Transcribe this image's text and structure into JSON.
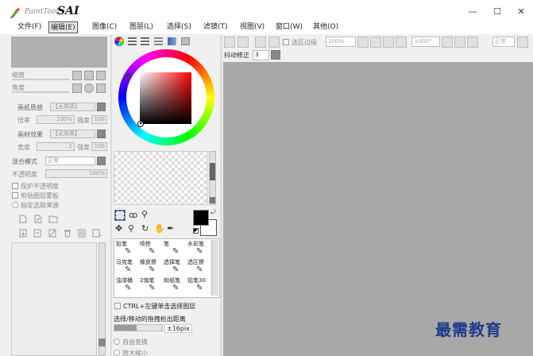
{
  "app": {
    "logo_small": "PaintTool",
    "logo_big": "SAI",
    "window_controls": [
      "—",
      "☐",
      "✕"
    ]
  },
  "menu": [
    {
      "label": "文件(F)"
    },
    {
      "label": "编辑(E)"
    },
    {
      "label": "图像(C)"
    },
    {
      "label": "图层(L)"
    },
    {
      "label": "选择(S)"
    },
    {
      "label": "滤镜(T)"
    },
    {
      "label": "视图(V)"
    },
    {
      "label": "窗口(W)"
    },
    {
      "label": "其他(O)"
    }
  ],
  "left_panel": {
    "zoom_label": "缩放",
    "angle_label": "角度",
    "paper_texture": {
      "label": "画纸质感",
      "value": "【无质感】",
      "scale_label": "倍率",
      "scale_value": "100%",
      "strength_label": "强度",
      "strength_value": "100"
    },
    "paper_effect": {
      "label": "画材效果",
      "value": "【无效果】",
      "width_label": "宽度",
      "width_value": "1",
      "strength_label": "强度",
      "strength_value": "100"
    },
    "blend": {
      "label": "混合模式",
      "value": "正常"
    },
    "opacity": {
      "label": "不透明度",
      "value": "100%"
    },
    "checks": [
      "保护不透明度",
      "剪贴图层蒙板",
      "指定选取来源"
    ]
  },
  "mid_panel": {
    "tools": [
      {
        "label": "铅笔"
      },
      {
        "label": "喷枪"
      },
      {
        "label": "笔"
      },
      {
        "label": "水彩笔"
      },
      {
        "label": "马克笔"
      },
      {
        "label": "橡皮擦"
      },
      {
        "label": "选择笔"
      },
      {
        "label": "选区擦"
      },
      {
        "label": "油漆桶"
      },
      {
        "label": "2值笔"
      },
      {
        "label": "和纸笔"
      },
      {
        "label": "铅笔30"
      }
    ],
    "ctrl_label": "CTRL+左键单击选择图层",
    "drag_label": "选择/移动的拖拽检出距离",
    "drag_value": "±16pix",
    "radio_labels": [
      "自由变换",
      "放大缩小"
    ]
  },
  "toolbar": {
    "selection_edge_label": "选区边缘",
    "zoom_value": "100%",
    "angle_value": "+000°",
    "blend_value": "正常",
    "stabilizer_label": "抖动修正",
    "stabilizer_value": "3"
  },
  "watermark": "最需教育"
}
